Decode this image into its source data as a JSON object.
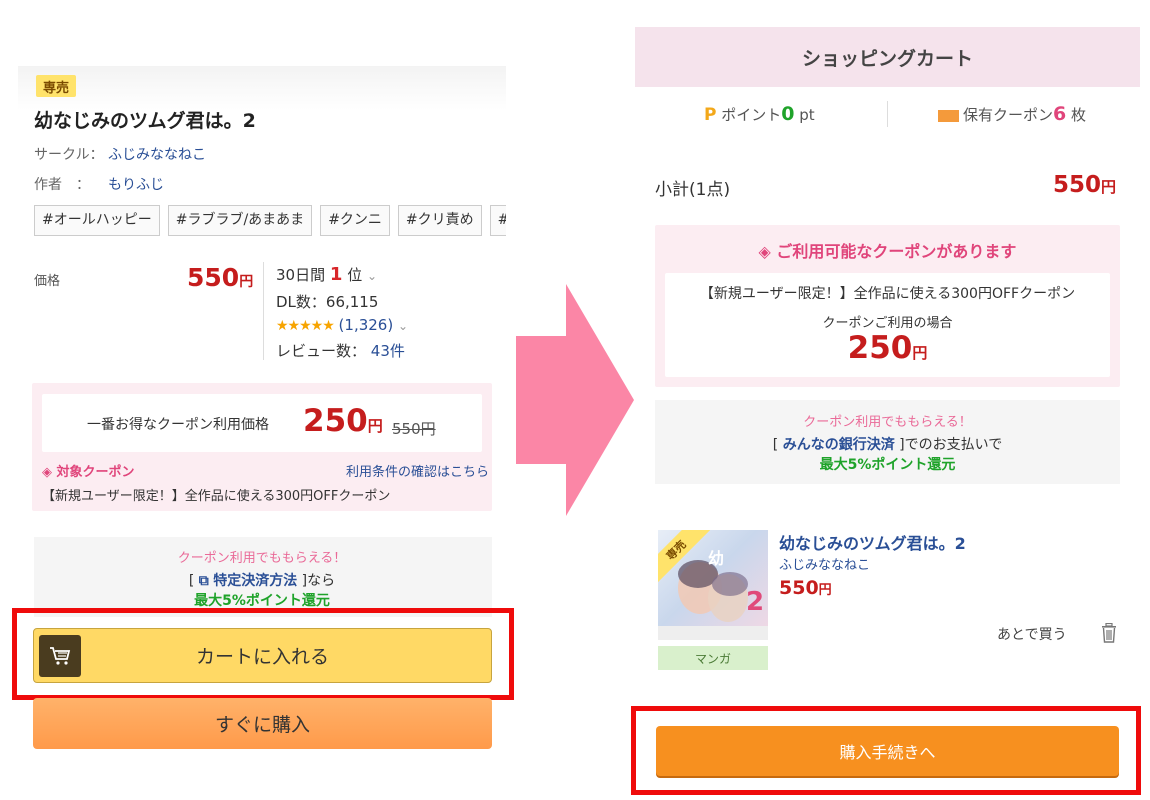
{
  "product": {
    "badge": "専売",
    "title": "幼なじみのツムグ君は。2",
    "circle_label": "サークル：",
    "circle_name": "ふじみななねこ",
    "author_label": "作者　：",
    "author_name": "もりふじ",
    "tags": [
      "#オールハッピー",
      "#ラブラブ/あまあま",
      "#クンニ",
      "#クリ責め",
      "#パイ"
    ]
  },
  "pricing": {
    "label": "価格",
    "price": "550",
    "yen": "円",
    "rank_prefix": "30日間",
    "rank_num": "1",
    "rank_suffix": "位",
    "dl_count": "DL数：66,115",
    "stars": "★★★★★",
    "rating_count": "(1,326)",
    "review_label": "レビュー数：",
    "review_count": "43件"
  },
  "coupon_left": {
    "label": "一番お得なクーポン利用価格",
    "price": "250",
    "yen": "円",
    "original": "550円",
    "target_label": "◈ 対象クーポン",
    "terms_link": "利用条件の確認はこちら",
    "description": "【新規ユーザー限定！】全作品に使える300円OFFクーポン"
  },
  "payment_left": {
    "line1": "クーポン利用でももらえる！",
    "bracket_open": "[ ",
    "link_icon": "⧉",
    "link": "特定決済方法",
    "bracket_close": " ]なら",
    "line3": "最大5%ポイント還元"
  },
  "buttons_left": {
    "cart": "カートに入れる",
    "buy_now": "すぐに購入"
  },
  "cart": {
    "header": "ショッピングカート",
    "points_icon": "P",
    "points_label": "ポイント",
    "points_value": "0",
    "points_unit": "pt",
    "coupons_label": "保有クーポン",
    "coupons_value": "6",
    "coupons_unit": "枚",
    "subtotal_label": "小計(1点)",
    "subtotal_price": "550",
    "yen": "円"
  },
  "coupon_right": {
    "title": "◈ ご利用可能なクーポンがあります",
    "description": "【新規ユーザー限定！】全作品に使える300円OFFクーポン",
    "use_label": "クーポンご利用の場合",
    "price": "250",
    "yen": "円"
  },
  "payment_right": {
    "line1": "クーポン利用でももらえる！",
    "bracket_open": "[ ",
    "link": "みんなの銀行決済",
    "bracket_close": " ]でのお支払いで",
    "line3": "最大5%ポイント還元"
  },
  "cart_item": {
    "ribbon": "専売",
    "title": "幼なじみのツムグ君は。2",
    "circle": "ふじみななねこ",
    "price": "550",
    "yen": "円",
    "category": "マンガ",
    "later": "あとで買う"
  },
  "buttons_right": {
    "checkout": "購入手続きへ"
  },
  "colors": {
    "price_red": "#c51d1d",
    "coupon_pink": "#e0457b",
    "cart_yellow": "#ffd965",
    "checkout_orange": "#f7901f",
    "highlight_red": "#ef0b0b",
    "arrow_pink": "#fb86a6"
  }
}
